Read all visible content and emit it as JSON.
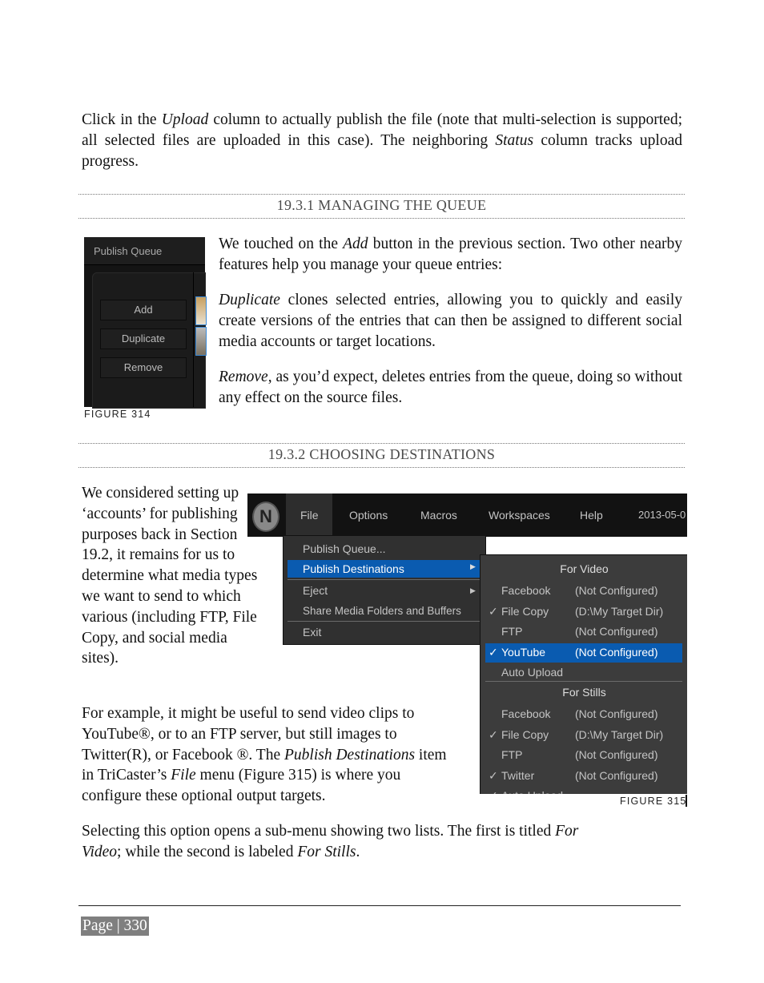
{
  "intro": {
    "p1a": "Click in the ",
    "p1b": "Upload",
    "p1c": " column to actually publish the file (note that multi-selection is supported; all selected files are uploaded in this case).  The neighboring ",
    "p1d": "Status",
    "p1e": " column tracks upload progress."
  },
  "section1": {
    "heading": "19.3.1 MANAGING THE QUEUE",
    "p1a": "We touched on the ",
    "p1b": "Add",
    "p1c": " button in the previous section.  Two other nearby features help you manage your queue entries:",
    "p2a": "Duplicate",
    "p2b": " clones selected entries, allowing you to quickly and easily create versions of the entries that can then be assigned to different social media accounts or target locations.",
    "p3a": "Remove",
    "p3b": ", as you’d expect, deletes entries from the queue, doing so without any effect on the source files.",
    "figure": {
      "title": "Publish Queue",
      "buttons": [
        "Add",
        "Duplicate",
        "Remove"
      ],
      "caption": "FIGURE 314"
    }
  },
  "section2": {
    "heading": "19.3.2 CHOOSING DESTINATIONS",
    "p1": "We considered setting up ‘accounts’ for publishing purposes back in Section 19.2, it remains for us to determine what media types we want to send to which various (including FTP, File Copy, and social media sites).",
    "p2a": "For example, it might be useful to send video clips to YouTube®, or to an FTP server, but still images to Twitter(R), or Facebook ®. The ",
    "p2b": "Publish Destinations",
    "p2c": " item in TriCaster’s ",
    "p2d": "File",
    "p2e": " menu (Figure 315) is where you configure these optional output targets.",
    "p3a": "Selecting this option opens a sub-menu showing two lists.  The first is titled ",
    "p3b": "For Video",
    "p3c": "; while the second is labeled ",
    "p3d": "For Stills",
    "p3e": ".",
    "figure": {
      "menubar": [
        "File",
        "Options",
        "Macros",
        "Workspaces",
        "Help",
        "2013-05-0"
      ],
      "file_menu": [
        "Publish Queue...",
        "Publish Destinations",
        "Eject",
        "Share Media Folders and Buffers",
        "Exit"
      ],
      "for_video": {
        "title": "For Video",
        "items": [
          {
            "check": "",
            "label": "Facebook",
            "value": "(Not Configured)"
          },
          {
            "check": "✓",
            "label": "File Copy",
            "value": "(D:\\My Target Dir)"
          },
          {
            "check": "",
            "label": "FTP",
            "value": "(Not Configured)"
          },
          {
            "check": "✓",
            "label": "YouTube",
            "value": "(Not Configured)"
          },
          {
            "check": "",
            "label": "Auto Upload",
            "value": ""
          }
        ]
      },
      "for_stills": {
        "title": "For Stills",
        "items": [
          {
            "check": "",
            "label": "Facebook",
            "value": "(Not Configured)"
          },
          {
            "check": "✓",
            "label": "File Copy",
            "value": "(D:\\My Target Dir)"
          },
          {
            "check": "",
            "label": "FTP",
            "value": "(Not Configured)"
          },
          {
            "check": "✓",
            "label": "Twitter",
            "value": "(Not Configured)"
          },
          {
            "check": "✓",
            "label": "Auto Upload",
            "value": ""
          }
        ]
      },
      "highlight_color": "#0a5bb0",
      "caption": "FIGURE 315"
    }
  },
  "footer": {
    "page": "Page | 330"
  }
}
